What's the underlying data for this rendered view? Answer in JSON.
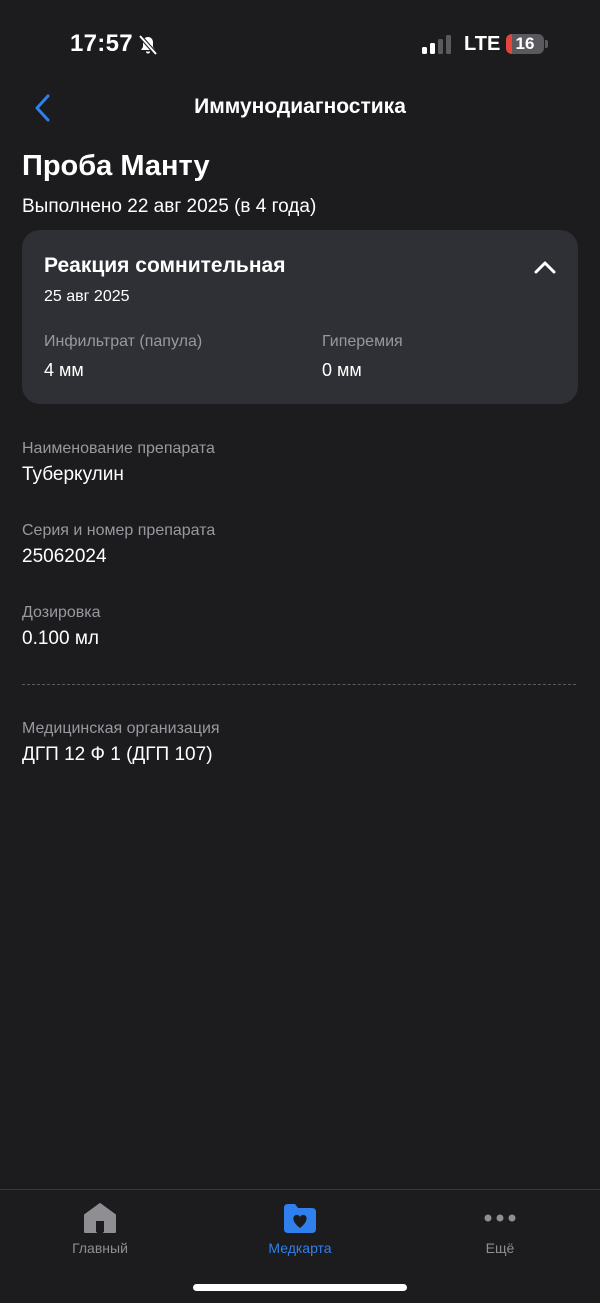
{
  "status_bar": {
    "time": "17:57",
    "network": "LTE",
    "battery_level": "16",
    "battery_fraction": 0.16,
    "signal_bars_active": 2,
    "silent_mode_icon": "bell-slash-icon"
  },
  "header": {
    "title": "Иммунодиагностика",
    "back_icon": "chevron-left-icon"
  },
  "record": {
    "title": "Проба Манту",
    "subtitle": "Выполнено 22 авг 2025 (в 4 года)"
  },
  "reaction_card": {
    "title": "Реакция сомнительная",
    "date": "25 авг 2025",
    "metrics": [
      {
        "label": "Инфильтрат (папула)",
        "value": "4 мм"
      },
      {
        "label": "Гиперемия",
        "value": "0 мм"
      }
    ],
    "toggle_icon": "chevron-up-icon"
  },
  "details": [
    {
      "label": "Наименование препарата",
      "value": "Туберкулин"
    },
    {
      "label": "Серия и номер препарата",
      "value": "25062024"
    },
    {
      "label": "Дозировка",
      "value": "0.100 мл"
    }
  ],
  "organization": {
    "label": "Медицинская организация",
    "value": "ДГП 12 Ф 1 (ДГП 107)"
  },
  "tab_bar": {
    "tabs": [
      {
        "label": "Главный",
        "icon": "home-icon",
        "active": false
      },
      {
        "label": "Медкарта",
        "icon": "folder-heart-icon",
        "active": true
      },
      {
        "label": "Ещё",
        "icon": "more-dots-icon",
        "active": false
      }
    ]
  },
  "colors": {
    "background": "#1c1c1e",
    "card": "#2f3035",
    "accent": "#2f80ed",
    "secondary_text": "#98989f",
    "battery_low": "#e5453a"
  }
}
